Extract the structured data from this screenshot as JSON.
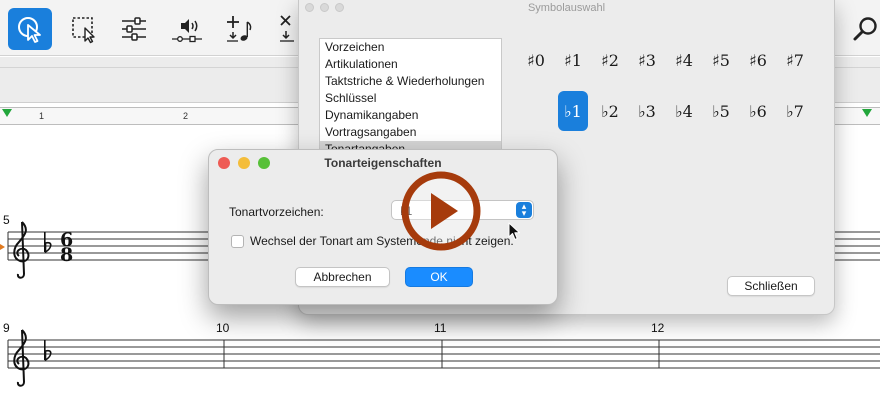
{
  "toolbar": {
    "tools": [
      {
        "name": "select",
        "active": true
      },
      {
        "name": "marquee-select",
        "active": false
      },
      {
        "name": "mixer-sliders",
        "active": false
      },
      {
        "name": "playback-speaker",
        "active": false
      },
      {
        "name": "add-note",
        "active": false
      },
      {
        "name": "remove-note",
        "active": false
      }
    ]
  },
  "ruler": {
    "numbers": [
      "1",
      "2"
    ]
  },
  "score": {
    "measure_numbers": [
      "5",
      "9",
      "10",
      "11",
      "12"
    ],
    "time_signature": {
      "top": "6",
      "bottom": "8"
    }
  },
  "palette": {
    "title": "Symbolauswahl",
    "categories": [
      "Vorzeichen",
      "Artikulationen",
      "Taktstriche & Wiederholungen",
      "Schlüssel",
      "Dynamikangaben",
      "Vortragsangaben",
      "Tonartangaben"
    ],
    "selected_category": "Tonartangaben",
    "sharps": [
      "♯0",
      "♯1",
      "♯2",
      "♯3",
      "♯4",
      "♯5",
      "♯6",
      "♯7"
    ],
    "flats": [
      "♭1",
      "♭2",
      "♭3",
      "♭4",
      "♭5",
      "♭6",
      "♭7"
    ],
    "selected_symbol": "♭1",
    "close_label": "Schließen"
  },
  "dialog": {
    "title": "Tonarteigenschaften",
    "field_label": "Tonartvorzeichen:",
    "select_value": "♭1",
    "checkbox_label": "Wechsel der Tonart am Systemende nicht zeigen.",
    "checkbox_checked": false,
    "cancel_label": "Abbrechen",
    "ok_label": "OK"
  },
  "colors": {
    "accent": "#1a7fdc",
    "play_button": "#a63b0c",
    "traffic_red": "#ee5b54",
    "traffic_yellow": "#f4bd3a",
    "traffic_green": "#57c038"
  }
}
